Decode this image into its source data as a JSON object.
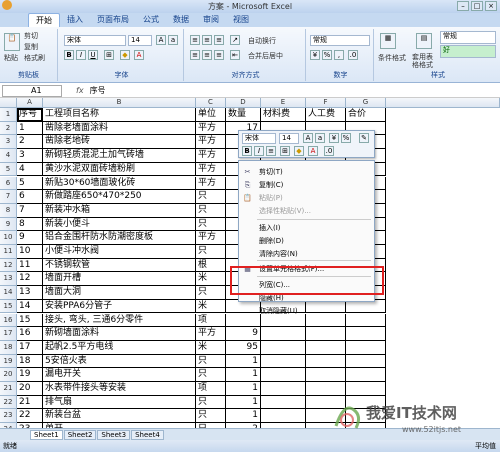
{
  "window": {
    "title": "方案 - Microsoft Excel"
  },
  "tabs": [
    "开始",
    "插入",
    "页面布局",
    "公式",
    "数据",
    "审阅",
    "视图"
  ],
  "ribbon": {
    "clipboard": {
      "paste": "粘贴",
      "cut": "剪切",
      "copy": "复制",
      "format_painter": "格式刷",
      "label": "剪贴板"
    },
    "font": {
      "name": "宋体",
      "size": "14",
      "label": "字体"
    },
    "alignment": {
      "wrap": "自动换行",
      "merge": "合并后居中",
      "label": "对齐方式"
    },
    "number": {
      "format": "常规",
      "label": "数字"
    },
    "styles": {
      "conditional": "条件格式",
      "table": "套用表格格式",
      "normal": "常规",
      "good": "好",
      "label": "样式"
    }
  },
  "formula_bar": {
    "cell_ref": "A1",
    "fx": "fx",
    "content": "序号"
  },
  "columns": [
    "A",
    "B",
    "C",
    "D",
    "E",
    "F",
    "G"
  ],
  "rows": [
    {
      "n": "1",
      "a": "序号",
      "b": "工程项目名称",
      "c": "单位",
      "d": "数量",
      "e": "材料费",
      "f": "人工费",
      "g": "合价"
    },
    {
      "n": "2",
      "a": "1",
      "b": "凿除老墙面涂料",
      "c": "平方",
      "d": "17",
      "e": "",
      "f": "",
      "g": ""
    },
    {
      "n": "3",
      "a": "2",
      "b": "凿除老地砖",
      "c": "平方",
      "d": "",
      "e": "",
      "f": "",
      "g": ""
    },
    {
      "n": "4",
      "a": "3",
      "b": "新砌轻质混泥土加气砖墙",
      "c": "平方",
      "d": "",
      "e": "",
      "f": "",
      "g": ""
    },
    {
      "n": "5",
      "a": "4",
      "b": "黄沙水泥双面砖墙粉刷",
      "c": "平方",
      "d": "",
      "e": "",
      "f": "",
      "g": ""
    },
    {
      "n": "6",
      "a": "5",
      "b": "新贴30*60墙面玻化砖",
      "c": "平方",
      "d": "",
      "e": "",
      "f": "",
      "g": ""
    },
    {
      "n": "7",
      "a": "6",
      "b": "新做踏座650*470*250",
      "c": "只",
      "d": "",
      "e": "",
      "f": "",
      "g": ""
    },
    {
      "n": "8",
      "a": "7",
      "b": "新装冲水箱",
      "c": "只",
      "d": "",
      "e": "",
      "f": "",
      "g": ""
    },
    {
      "n": "9",
      "a": "8",
      "b": "新装小便斗",
      "c": "只",
      "d": "",
      "e": "",
      "f": "",
      "g": ""
    },
    {
      "n": "10",
      "a": "9",
      "b": "铝合金围杆防水防潮密度板",
      "c": "平方",
      "d": "",
      "e": "",
      "f": "",
      "g": ""
    },
    {
      "n": "11",
      "a": "10",
      "b": "小便斗冲水阀",
      "c": "只",
      "d": "",
      "e": "",
      "f": "",
      "g": ""
    },
    {
      "n": "12",
      "a": "11",
      "b": "不锈钢软管",
      "c": "根",
      "d": "",
      "e": "",
      "f": "",
      "g": ""
    },
    {
      "n": "13",
      "a": "12",
      "b": "墙面开槽",
      "c": "米",
      "d": "",
      "e": "",
      "f": "",
      "g": ""
    },
    {
      "n": "14",
      "a": "13",
      "b": "墙面大洞",
      "c": "只",
      "d": "",
      "e": "",
      "f": "",
      "g": ""
    },
    {
      "n": "15",
      "a": "14",
      "b": "安装PPA6分管子",
      "c": "米",
      "d": "",
      "e": "",
      "f": "",
      "g": ""
    },
    {
      "n": "16",
      "a": "15",
      "b": "接头, 弯头, 三通6分零件",
      "c": "项",
      "d": "",
      "e": "",
      "f": "",
      "g": ""
    },
    {
      "n": "17",
      "a": "16",
      "b": "新砌墙面涂料",
      "c": "平方",
      "d": "9",
      "e": "",
      "f": "",
      "g": ""
    },
    {
      "n": "18",
      "a": "17",
      "b": "起帆2.5平方电线",
      "c": "米",
      "d": "95",
      "e": "",
      "f": "",
      "g": ""
    },
    {
      "n": "19",
      "a": "18",
      "b": "5安倍火表",
      "c": "只",
      "d": "1",
      "e": "",
      "f": "",
      "g": ""
    },
    {
      "n": "20",
      "a": "19",
      "b": "漏电开关",
      "c": "只",
      "d": "1",
      "e": "",
      "f": "",
      "g": ""
    },
    {
      "n": "21",
      "a": "20",
      "b": "水表带件接头等安装",
      "c": "项",
      "d": "1",
      "e": "",
      "f": "",
      "g": ""
    },
    {
      "n": "22",
      "a": "21",
      "b": "排气扇",
      "c": "只",
      "d": "1",
      "e": "",
      "f": "",
      "g": ""
    },
    {
      "n": "23",
      "a": "22",
      "b": "新装台盆",
      "c": "只",
      "d": "1",
      "e": "",
      "f": "",
      "g": ""
    },
    {
      "n": "24",
      "a": "23",
      "b": "单开",
      "c": "只",
      "d": "2",
      "e": "",
      "f": "",
      "g": ""
    }
  ],
  "mini_toolbar": {
    "font": "宋体",
    "size": "14"
  },
  "context_menu": [
    {
      "label": "剪切(T)",
      "icon": "scissors-icon",
      "disabled": false
    },
    {
      "label": "复制(C)",
      "icon": "copy-icon",
      "disabled": false
    },
    {
      "label": "粘贴(P)",
      "icon": "paste-icon",
      "disabled": true
    },
    {
      "label": "选择性粘贴(V)...",
      "icon": "",
      "disabled": true
    },
    {
      "label": "插入(I)",
      "icon": "",
      "disabled": false
    },
    {
      "label": "删除(D)",
      "icon": "",
      "disabled": false
    },
    {
      "label": "清除内容(N)",
      "icon": "",
      "disabled": false
    },
    {
      "label": "设置单元格格式(F)...",
      "icon": "format-cells-icon",
      "disabled": false
    },
    {
      "label": "列宽(C)...",
      "icon": "",
      "disabled": false
    },
    {
      "label": "隐藏(H)",
      "icon": "",
      "disabled": false
    },
    {
      "label": "取消隐藏(U)",
      "icon": "",
      "disabled": false
    }
  ],
  "sheets": [
    "Sheet1",
    "Sheet2",
    "Sheet3",
    "Sheet4"
  ],
  "active_sheet": "Sheet1",
  "status": {
    "left": "就绪",
    "right": "平均值"
  },
  "watermark": {
    "text": "我爱IT技术网",
    "sub": "www.52itjs.net"
  }
}
